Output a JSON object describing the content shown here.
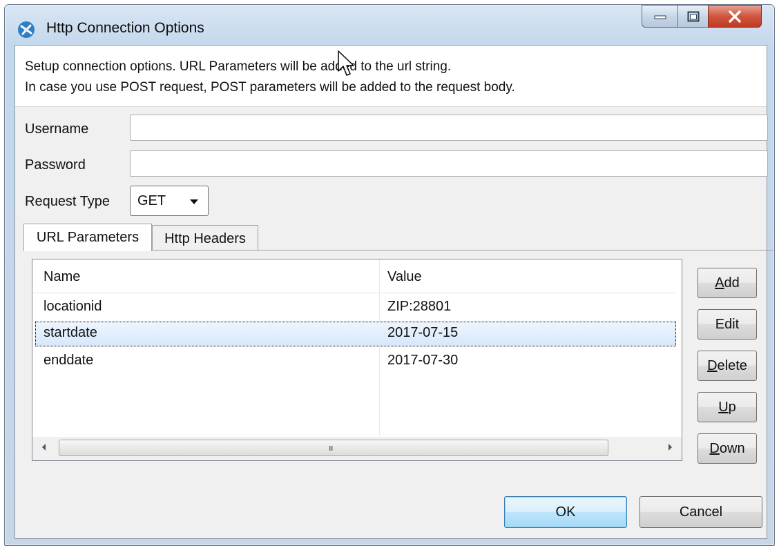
{
  "window": {
    "title": "Http Connection Options",
    "icon": "app-icon",
    "controls": [
      "minimize-icon",
      "maximize-icon",
      "close-icon"
    ]
  },
  "info": {
    "line1": "Setup connection options. URL Parameters will be added to the url string.",
    "line2": "In case you use POST request, POST parameters will be added to the request body."
  },
  "form": {
    "username_label": "Username",
    "username_value": "",
    "password_label": "Password",
    "password_value": "",
    "request_type_label": "Request Type",
    "request_type_value": "GET"
  },
  "tabs": [
    {
      "label": "URL Parameters",
      "active": true
    },
    {
      "label": "Http Headers",
      "active": false
    }
  ],
  "table": {
    "columns": [
      "Name",
      "Value"
    ],
    "rows": [
      {
        "name": "locationid",
        "value": "ZIP:28801",
        "selected": false
      },
      {
        "name": "startdate",
        "value": "2017-07-15",
        "selected": true
      },
      {
        "name": "enddate",
        "value": "2017-07-30",
        "selected": false
      }
    ],
    "scrollbar_grip": "III"
  },
  "side_buttons": {
    "add": {
      "mnemonic": "A",
      "rest": "dd"
    },
    "edit": "Edit",
    "delete": {
      "mnemonic": "D",
      "rest": "elete"
    },
    "up": {
      "mnemonic": "U",
      "rest": "p"
    },
    "down": {
      "mnemonic": "D",
      "rest": "own"
    }
  },
  "footer": {
    "ok": "OK",
    "cancel": "Cancel"
  },
  "colors": {
    "accent": "#3c7fb1",
    "close": "#c23a22",
    "selection": "#d6e8fb"
  }
}
